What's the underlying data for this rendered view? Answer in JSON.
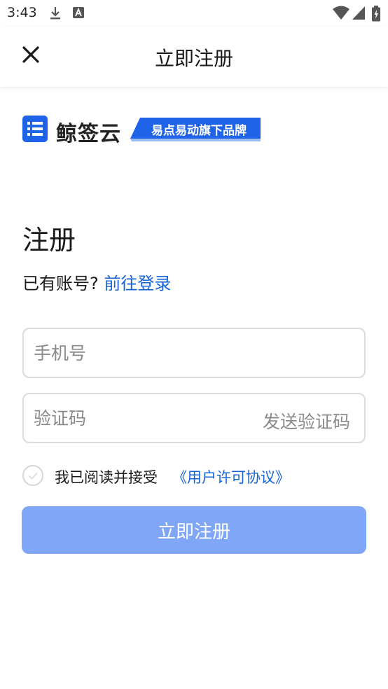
{
  "status_bar": {
    "time": "3:43",
    "icons": [
      "download-icon",
      "text-a-icon",
      "wifi-icon",
      "signal-icon",
      "battery-icon"
    ]
  },
  "header": {
    "title": "立即注册",
    "close_icon": "close-icon"
  },
  "brand": {
    "name": "鲸签云",
    "tagline": "易点易动旗下品牌",
    "accent": "#1f63e8"
  },
  "form": {
    "heading": "注册",
    "login_prompt": "已有账号?",
    "login_link": "前往登录",
    "phone_placeholder": "手机号",
    "code_placeholder": "验证码",
    "send_code_label": "发送验证码",
    "agree_text": "我已阅读并接受",
    "agree_link": "《用户许可协议》",
    "submit_label": "立即注册"
  },
  "colors": {
    "link": "#1764d8",
    "button_disabled": "#7fa6f7",
    "field_border": "#dcdcdc"
  }
}
